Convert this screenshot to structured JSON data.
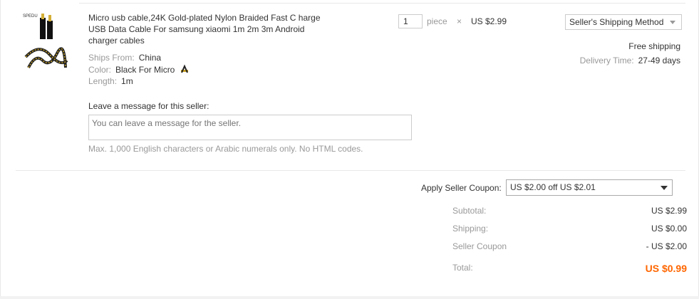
{
  "product": {
    "title": "Micro usb cable,24K Gold-plated Nylon Braided Fast C harge USB Data Cable For samsung xiaomi 1m 2m 3m Android charger cables",
    "brand_mark": "SPEDU",
    "ships_from_label": "Ships From:",
    "ships_from_value": "China",
    "color_label": "Color:",
    "color_value": "Black For Micro",
    "length_label": "Length:",
    "length_value": "1m"
  },
  "order": {
    "quantity": "1",
    "unit": "piece",
    "times": "×",
    "price": "US $2.99"
  },
  "shipping": {
    "method": "Seller's Shipping Method",
    "free": "Free shipping",
    "delivery_label": "Delivery Time:",
    "delivery_value": "27-49 days"
  },
  "message": {
    "label": "Leave a message for this seller:",
    "placeholder": "You can leave a message for the seller.",
    "note": "Max. 1,000 English characters or Arabic numerals only. No HTML codes."
  },
  "coupon": {
    "label": "Apply Seller Coupon:",
    "selected": "US $2.00 off US $2.01"
  },
  "summary": {
    "subtotal_label": "Subtotal:",
    "subtotal_value": "US $2.99",
    "shipping_label": "Shipping:",
    "shipping_value": "US $0.00",
    "coupon_label": "Seller Coupon",
    "coupon_value": "- US $2.00",
    "total_label": "Total:",
    "total_value": "US $0.99"
  },
  "colors": {
    "total": "#ff6600",
    "border": "#e8e8e8",
    "muted": "#999999"
  }
}
